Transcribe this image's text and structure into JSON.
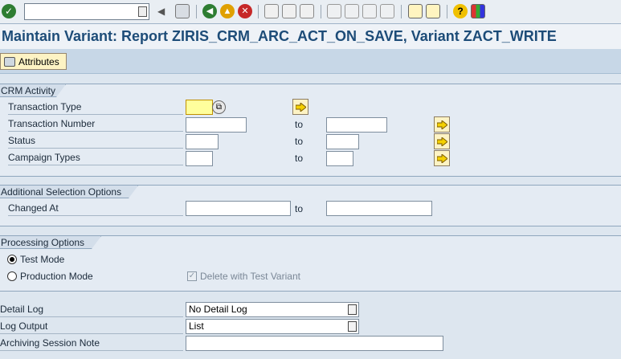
{
  "toolbar": {
    "command_field_value": "",
    "icons": [
      "check-icon",
      "back-nav-icon",
      "save-icon",
      "back-icon",
      "exit-icon",
      "cancel-icon",
      "print-icon",
      "find-icon",
      "find-next-icon",
      "first-page-icon",
      "prev-page-icon",
      "next-page-icon",
      "last-page-icon",
      "new-session-icon",
      "shortcut-icon",
      "help-icon",
      "layout-icon"
    ]
  },
  "title": "Maintain Variant: Report ZIRIS_CRM_ARC_ACT_ON_SAVE, Variant ZACT_WRITE",
  "app_toolbar": {
    "attributes_label": "Attributes"
  },
  "crm_activity": {
    "frame_title": "CRM Activity",
    "to_label": "to",
    "rows": [
      {
        "label": "Transaction Type",
        "from": "",
        "to": null
      },
      {
        "label": "Transaction Number",
        "from": "",
        "to": ""
      },
      {
        "label": "Status",
        "from": "",
        "to": ""
      },
      {
        "label": "Campaign Types",
        "from": "",
        "to": ""
      }
    ]
  },
  "additional": {
    "frame_title": "Additional Selection Options",
    "changed_at_label": "Changed At",
    "to_label": "to",
    "from": "",
    "to": ""
  },
  "processing": {
    "frame_title": "Processing Options",
    "test_mode_label": "Test Mode",
    "production_mode_label": "Production Mode",
    "delete_with_test_label": "Delete with Test Variant",
    "selected_mode": "test",
    "delete_with_test_checked": true
  },
  "bottom": {
    "detail_log_label": "Detail Log",
    "detail_log_value": "No Detail Log",
    "log_output_label": "Log Output",
    "log_output_value": "List",
    "session_note_label": "Archiving Session Note",
    "session_note_value": ""
  },
  "colors": {
    "title": "#1d4c78",
    "required_field": "#ffff9c",
    "button_yellow": "#fdf3c4",
    "background": "#dde6ef"
  }
}
